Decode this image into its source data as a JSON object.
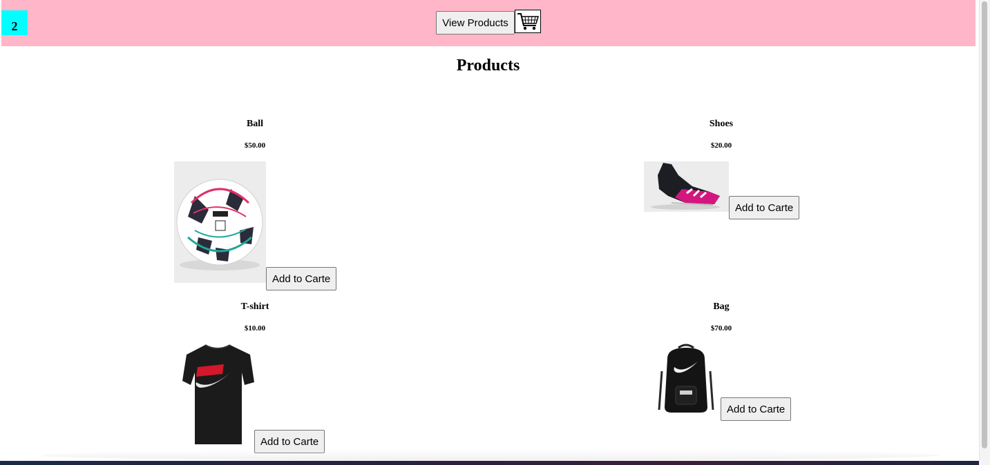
{
  "header": {
    "cart_count": "2",
    "view_products_label": "View Products",
    "cart_icon": "shopping-cart-icon",
    "background_color": "#ffb6c8",
    "counter_color": "#00ffff"
  },
  "page": {
    "title": "Products"
  },
  "products": [
    {
      "name": "Ball",
      "price": "$50.00",
      "button": "Add to Carte",
      "image_icon": "soccer-ball-image"
    },
    {
      "name": "Shoes",
      "price": "$20.00",
      "button": "Add to Carte",
      "image_icon": "football-boot-image"
    },
    {
      "name": "T-shirt",
      "price": "$10.00",
      "button": "Add to Carte",
      "image_icon": "tshirt-image"
    },
    {
      "name": "Bag",
      "price": "$70.00",
      "button": "Add to Carte",
      "image_icon": "backpack-image"
    }
  ]
}
